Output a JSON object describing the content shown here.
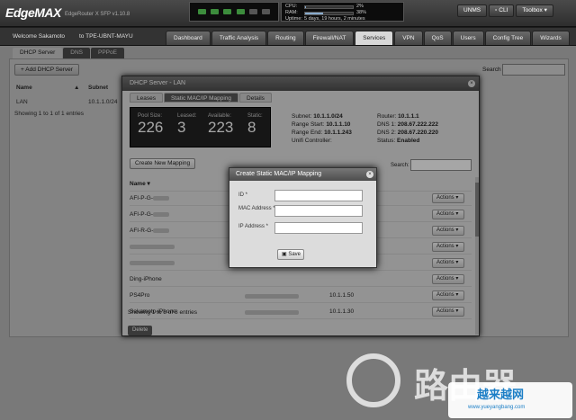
{
  "brand": {
    "logo": "EdgeMAX",
    "subtitle": "EdgeRouter X SFP v1.10.8"
  },
  "system": {
    "cpu_label": "CPU:",
    "cpu_value": "2%",
    "cpu_fill": 0.02,
    "ram_label": "RAM:",
    "ram_value": "38%",
    "ram_fill": 0.38,
    "uptime_label": "Uptime:",
    "uptime_value": "5 days, 19 hours, 2 minutes"
  },
  "topbuttons": {
    "unms": "UNMS",
    "cli": "CLI",
    "toolbox": "Toolbox"
  },
  "header": {
    "welcome": "Welcome Sakamoto",
    "host": "to TPE-UBNT-MAYU"
  },
  "tabs": [
    "Dashboard",
    "Traffic Analysis",
    "Routing",
    "Firewall/NAT",
    "Services",
    "VPN",
    "QoS",
    "Users",
    "Config Tree",
    "Wizards"
  ],
  "subtabs": [
    "DHCP Server",
    "DNS",
    "PPPoE"
  ],
  "page": {
    "add_button": "Add DHCP Server",
    "search_label": "Search",
    "col_name": "Name",
    "col_subnet": "Subnet",
    "row_name": "LAN",
    "row_subnet": "10.1.1.0/24",
    "showing": "Showing 1 to 1 of 1 entries"
  },
  "dhcp_modal": {
    "title": "DHCP Server - LAN",
    "tabs": [
      "Leases",
      "Static MAC/IP Mapping",
      "Details"
    ],
    "stats": [
      {
        "label": "Pool Size:",
        "value": "226"
      },
      {
        "label": "Leased:",
        "value": "3"
      },
      {
        "label": "Available:",
        "value": "223"
      },
      {
        "label": "Static:",
        "value": "8"
      }
    ],
    "info": {
      "subnet_label": "Subnet:",
      "subnet": "10.1.1.0/24",
      "range_start_label": "Range Start:",
      "range_start": "10.1.1.10",
      "range_end_label": "Range End:",
      "range_end": "10.1.1.243",
      "unifi_label": "Unifi Controller:",
      "router_label": "Router:",
      "router": "10.1.1.1",
      "dns1_label": "DNS 1:",
      "dns1": "208.67.222.222",
      "dns2_label": "DNS 2:",
      "dns2": "208.67.220.220",
      "status_label": "Status:",
      "status": "Enabled"
    },
    "create_button": "Create New Mapping",
    "search_label": "Search:",
    "col_name": "Name",
    "rows": [
      {
        "name": "AFI-P-G-",
        "ip": ""
      },
      {
        "name": "AFI-P-G-",
        "ip": ""
      },
      {
        "name": "AFI-R-G-",
        "ip": ""
      },
      {
        "name": "",
        "ip": ""
      },
      {
        "name": "",
        "ip": ""
      },
      {
        "name": "Ding-iPhone",
        "ip": ""
      },
      {
        "name": "PS4Pro",
        "ip": "10.1.1.50"
      },
      {
        "name": "Sakamoto-iPhone",
        "ip": "10.1.1.30"
      }
    ],
    "actions": "Actions",
    "showing": "Showing 1 to 8 of 8 entries",
    "delete": "Delete"
  },
  "static_modal": {
    "title": "Create Static MAC/IP Mapping",
    "id_label": "ID *",
    "mac_label": "MAC Address *",
    "ip_label": "IP Address *",
    "save": "Save"
  },
  "watermark": {
    "text": "路由器",
    "badge_title": "越来越网",
    "badge_url": "www.yueyangbang.com"
  }
}
